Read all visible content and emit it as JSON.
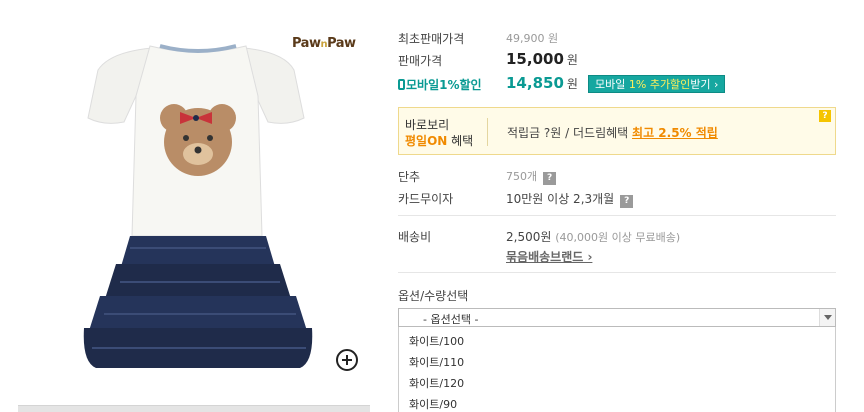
{
  "brand": {
    "logo_left": "Paw",
    "logo_mid": "n",
    "logo_right": "Paw"
  },
  "product": {
    "original_price_label": "최초판매가격",
    "original_price": "49,900 원",
    "sale_price_label": "판매가격",
    "sale_price": "15,000",
    "currency": "원",
    "mobile_label": "모바일1%할인",
    "mobile_price": "14,850",
    "mobile_btn_pre": "모바일",
    "mobile_btn_hl": "1% 추가할인",
    "mobile_btn_post": "받기 ›"
  },
  "benefit": {
    "line1": "바로보리",
    "line2_hl": "평일ON",
    "line2_post": " 혜택",
    "text": "적립금 ?원 / 더드림혜택 ",
    "link": "최고 2.5% 적립",
    "help": "?"
  },
  "details": {
    "short_label": "단추",
    "stock": "750개",
    "card_label": "카드무이자",
    "card_value": "10만원 이상 2,3개월",
    "help": "?",
    "shipping_label": "배송비",
    "shipping_fee": "2,500원",
    "shipping_free": "(40,000원 이상 무료배송)",
    "bundle_link": "묶음배송브랜드 ›"
  },
  "options": {
    "label": "옵션/수량선택",
    "placeholder": "- 옵션선택 -",
    "items": [
      "화이트/100",
      "화이트/110",
      "화이트/120",
      "화이트/90"
    ]
  },
  "colors": {
    "accent": "#0a9a93",
    "orange": "#f08a00",
    "navy": "#1f2b4a"
  }
}
